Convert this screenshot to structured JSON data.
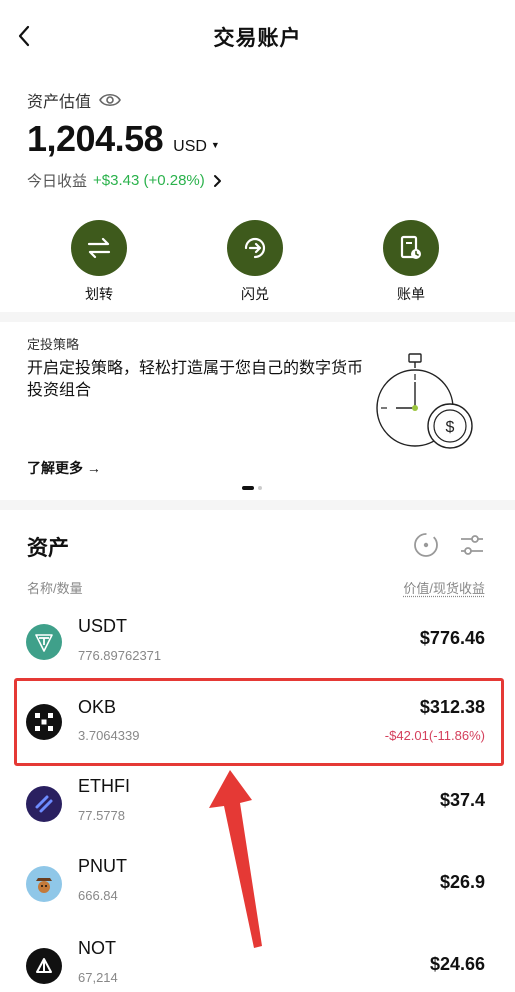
{
  "header": {
    "title": "交易账户",
    "back_icon": "chevron-left-icon"
  },
  "overview": {
    "estimate_label": "资产估值",
    "balance": "1,204.58",
    "currency": "USD",
    "today_label": "今日收益",
    "today_gain": "+$3.43 (+0.28%)"
  },
  "actions": [
    {
      "label": "划转",
      "icon": "transfer-icon"
    },
    {
      "label": "闪兑",
      "icon": "convert-icon"
    },
    {
      "label": "账单",
      "icon": "bill-icon"
    }
  ],
  "promo": {
    "kicker": "定投策略",
    "text": "开启定投策略，轻松打造属于您自己的数字货币投资组合",
    "link": "了解更多 →",
    "art": "stopwatch-dollar-illustration"
  },
  "assets": {
    "title": "资产",
    "col_left": "名称/数量",
    "col_right": "价值/现货收益",
    "items": [
      {
        "symbol": "USDT",
        "qty": "776.89762371",
        "value": "$776.46",
        "pnl": "",
        "color": "#3fa08a"
      },
      {
        "symbol": "OKB",
        "qty": "3.7064339",
        "value": "$312.38",
        "pnl": "-$42.01(-11.86%)",
        "color": "#111111"
      },
      {
        "symbol": "ETHFI",
        "qty": "77.5778",
        "value": "$37.4",
        "pnl": "",
        "color": "#2a2060"
      },
      {
        "symbol": "PNUT",
        "qty": "666.84",
        "value": "$26.9",
        "pnl": "",
        "color": "#8fc7e8"
      },
      {
        "symbol": "NOT",
        "qty": "67,214",
        "value": "$24.66",
        "pnl": "",
        "color": "#111111"
      }
    ]
  },
  "colors": {
    "accent": "#3e5a1c",
    "gain": "#2bb24c",
    "loss": "#d4405c",
    "highlight": "#e53935"
  }
}
